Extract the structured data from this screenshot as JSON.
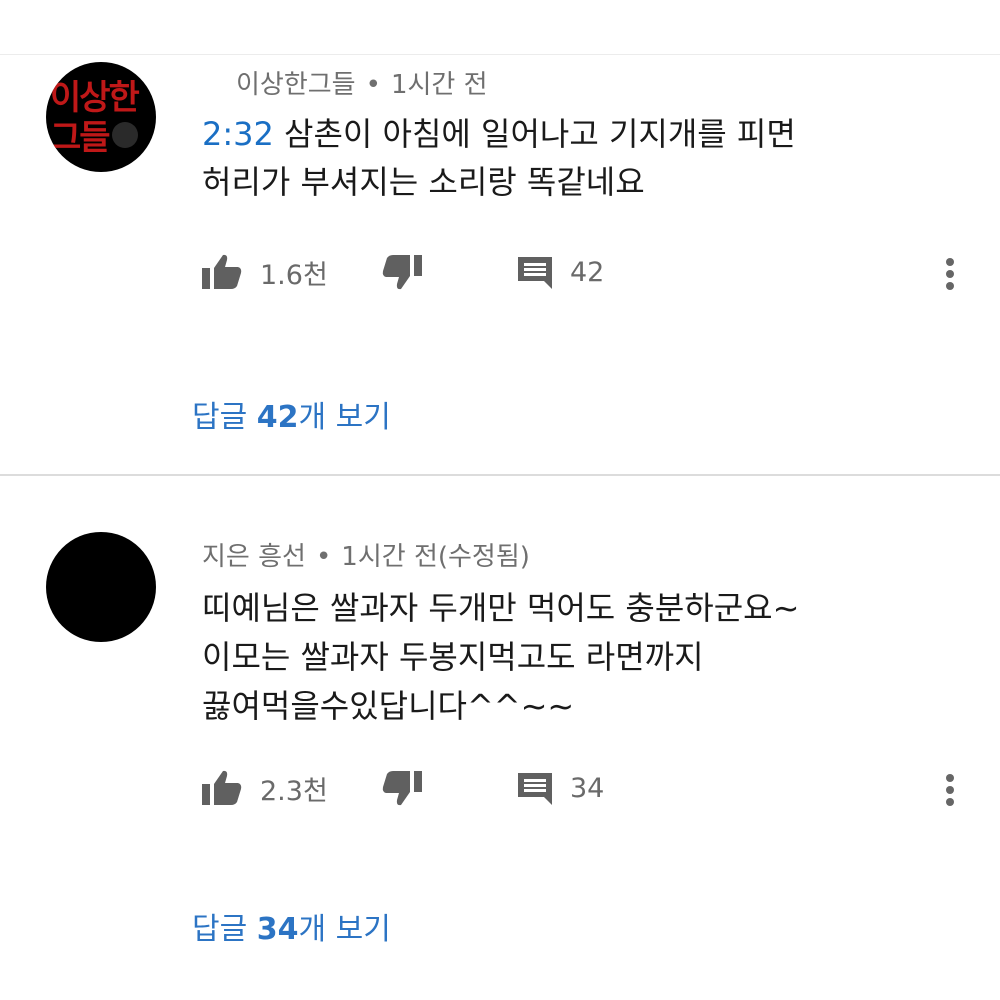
{
  "comments": [
    {
      "author": "이상한그들",
      "time": "1시간 전",
      "avatar_text": "이상한\n그들",
      "timestamp_link": "2:32",
      "text_line1": " 삼촌이 아침에 일어나고 기지개를 피면",
      "text_line2": "허리가 부셔지는 소리랑 똑같네요",
      "likes": "1.6천",
      "reply_count": "42",
      "replies_prefix": "답글 ",
      "replies_number": "42",
      "replies_suffix": "개 보기"
    },
    {
      "author": "지은 흥선",
      "time": "1시간 전(수정됨)",
      "text_line1": "띠예님은 쌀과자 두개만 먹어도 충분하군요~",
      "text_line2": "이모는 쌀과자 두봉지먹고도 라면까지",
      "text_line3": "끓여먹을수있답니다^^~~",
      "likes": "2.3천",
      "reply_count": "34",
      "replies_prefix": "답글 ",
      "replies_number": "34",
      "replies_suffix": "개 보기"
    }
  ],
  "separator": "•",
  "icons": {
    "like": "thumbs-up-icon",
    "dislike": "thumbs-down-icon",
    "reply": "comment-icon",
    "more": "more-vertical-icon"
  },
  "colors": {
    "link": "#2c74c4",
    "meta": "#6f6f6f",
    "icon": "#606060",
    "avatar_text": "#e11d1d"
  }
}
